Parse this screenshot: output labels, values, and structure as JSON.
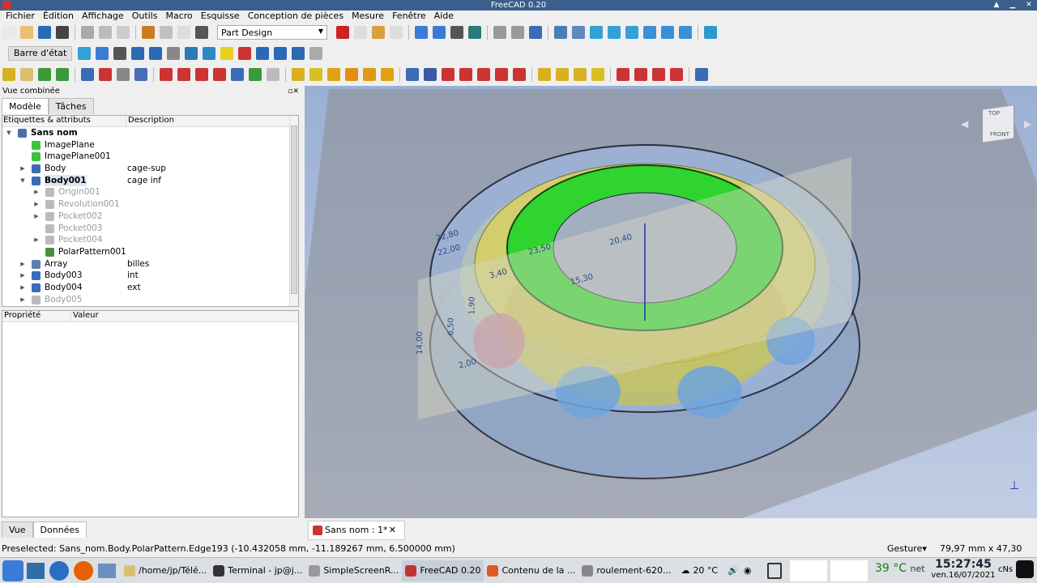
{
  "window": {
    "title": "FreeCAD 0.20"
  },
  "menu": [
    "Fichier",
    "Édition",
    "Affichage",
    "Outils",
    "Macro",
    "Esquisse",
    "Conception de pièces",
    "Mesure",
    "Fenêtre",
    "Aide"
  ],
  "toolbar": {
    "workbench": "Part Design",
    "status_bar_button": "Barre d'état"
  },
  "combo": {
    "title": "Vue combinée",
    "tabs": [
      "Modèle",
      "Tâches"
    ],
    "tree_headers": [
      "Étiquettes & attributs",
      "Description"
    ],
    "tree": [
      {
        "label": "Sans nom",
        "desc": "",
        "level": 0,
        "exp": "open",
        "bold": true,
        "icon": "#4a6fa5"
      },
      {
        "label": "ImagePlane",
        "desc": "",
        "level": 1,
        "exp": "",
        "icon": "#3bc33b"
      },
      {
        "label": "ImagePlane001",
        "desc": "",
        "level": 1,
        "exp": "",
        "icon": "#3bc33b"
      },
      {
        "label": "Body",
        "desc": "cage-sup",
        "level": 1,
        "exp": "closed",
        "icon": "#3a6bb5"
      },
      {
        "label": "Body001",
        "desc": "cage inf",
        "level": 1,
        "exp": "open",
        "bold": true,
        "sel": true,
        "icon": "#3a6bb5"
      },
      {
        "label": "Origin001",
        "desc": "",
        "level": 2,
        "exp": "closed",
        "dim": true,
        "icon": "#bbbbbb"
      },
      {
        "label": "Revolution001",
        "desc": "",
        "level": 2,
        "exp": "closed",
        "dim": true,
        "icon": "#bbbbbb"
      },
      {
        "label": "Pocket002",
        "desc": "",
        "level": 2,
        "exp": "closed",
        "dim": true,
        "icon": "#bbbbbb"
      },
      {
        "label": "Pocket003",
        "desc": "",
        "level": 2,
        "exp": "",
        "dim": true,
        "icon": "#bbbbbb"
      },
      {
        "label": "Pocket004",
        "desc": "",
        "level": 2,
        "exp": "closed",
        "dim": true,
        "icon": "#bbbbbb"
      },
      {
        "label": "PolarPattern001",
        "desc": "",
        "level": 2,
        "exp": "",
        "icon": "#4c8c3a"
      },
      {
        "label": "Array",
        "desc": "billes",
        "level": 1,
        "exp": "closed",
        "icon": "#5a7fb0"
      },
      {
        "label": "Body003",
        "desc": "int",
        "level": 1,
        "exp": "closed",
        "icon": "#3a6bb5"
      },
      {
        "label": "Body004",
        "desc": "ext",
        "level": 1,
        "exp": "closed",
        "icon": "#3a6bb5"
      },
      {
        "label": "Body005",
        "desc": "",
        "level": 1,
        "exp": "closed",
        "dim": true,
        "icon": "#bbbbbb"
      }
    ],
    "prop_headers": [
      "Propriété",
      "Valeur"
    ],
    "bottom_tabs": [
      "Vue",
      "Données"
    ]
  },
  "viewport": {
    "navcube": {
      "top": "TOP",
      "front": "FRONT"
    },
    "dimensions": [
      "22,80",
      "22,00",
      "23,50",
      "20,40",
      "3,40",
      "15,30",
      "1,90",
      "6,50",
      "14,00",
      "2,00"
    ]
  },
  "document_tab": {
    "label": "Sans nom : 1*",
    "close": "✕"
  },
  "status": {
    "preselected": "Preselected: Sans_nom.Body.PolarPattern.Edge193 (-10.432058 mm, -11.189267 mm, 6.500000 mm)",
    "nav_style": "Gesture▾",
    "dims": "79,97 mm x 47,30 mm"
  },
  "taskbar": {
    "tasks": [
      {
        "label": "/home/jp/Télé...",
        "color": "#d8c070"
      },
      {
        "label": "Terminal - jp@j...",
        "color": "#333333"
      },
      {
        "label": "SimpleScreenR...",
        "color": "#999999"
      },
      {
        "label": "FreeCAD 0.20",
        "color": "#c33333",
        "active": true
      },
      {
        "label": "Contenu de la ...",
        "color": "#e05a20"
      },
      {
        "label": "roulement-620...",
        "color": "#888888"
      }
    ],
    "weather": "20 °C",
    "temp": "39 °C",
    "net": "net",
    "time": "15:27:45",
    "date": "ven.16/07/2021",
    "cns": "cNs"
  },
  "colors": {
    "titlebar": "#3b5e8c",
    "accent_green": "#2fd42f",
    "yellow_cage": "#d8d060"
  }
}
